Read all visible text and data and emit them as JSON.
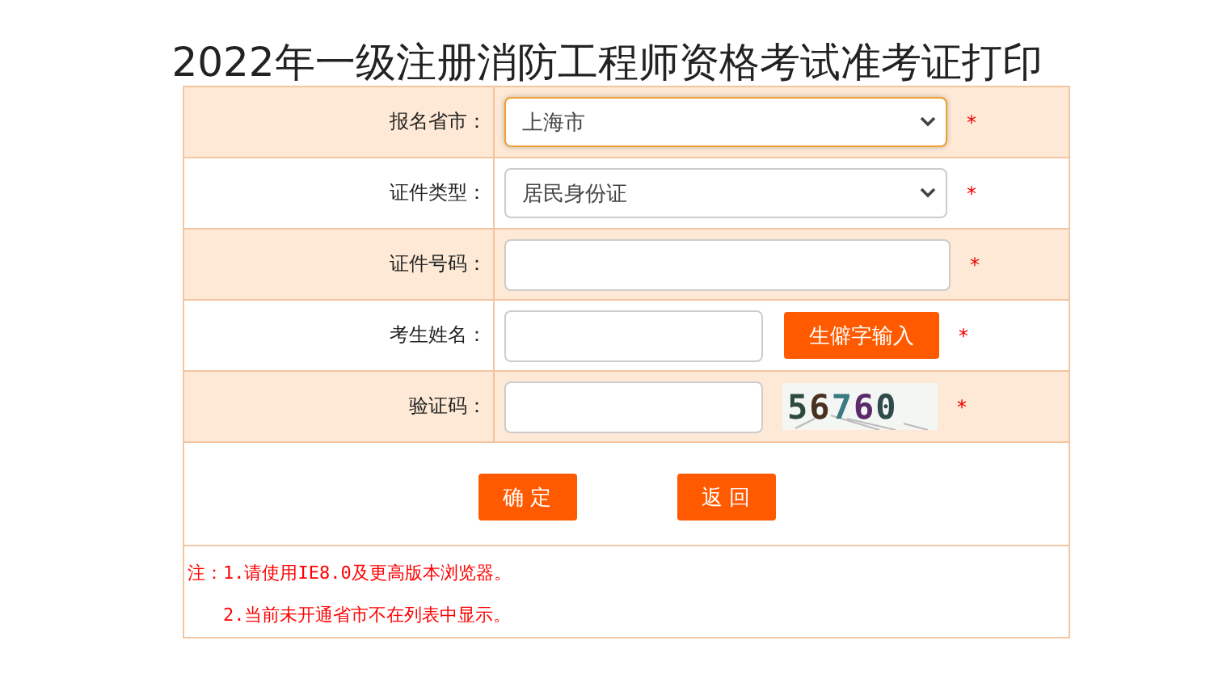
{
  "title": "2022年一级注册消防工程师资格考试准考证打印",
  "form": {
    "rows": [
      {
        "kind": "select",
        "label": "报名省市：",
        "value": "上海市",
        "focused": true,
        "required_mark": "*"
      },
      {
        "kind": "select",
        "label": "证件类型：",
        "value": "居民身份证",
        "focused": false,
        "required_mark": "*"
      },
      {
        "kind": "input",
        "label": "证件号码：",
        "required_mark": "*"
      },
      {
        "kind": "input_button",
        "label": "考生姓名：",
        "button": "生僻字输入",
        "required_mark": "*"
      },
      {
        "kind": "captcha",
        "label": "验证码：",
        "captcha": "56760",
        "required_mark": "*"
      }
    ],
    "buttons": [
      "确 定",
      "返 回"
    ],
    "notes": [
      "注：1.请使用IE8.0及更高版本浏览器。",
      "2.当前未开通省市不在列表中显示。"
    ]
  }
}
